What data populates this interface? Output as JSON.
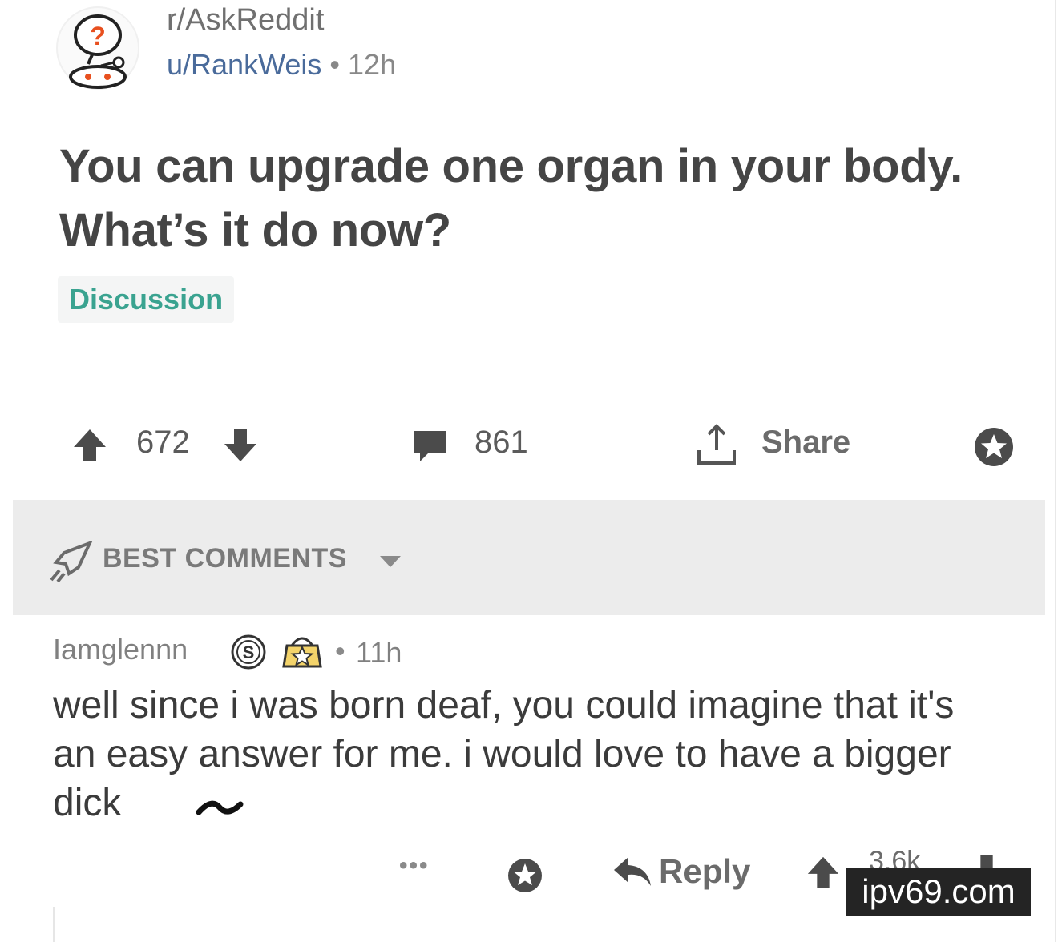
{
  "post": {
    "subreddit": "r/AskReddit",
    "author": "u/RankWeis",
    "separator": "•",
    "age": "12h",
    "title": "You can upgrade one organ in your body. What’s it do now?",
    "flair": "Discussion",
    "score": "672",
    "comments": "861",
    "share_label": "Share"
  },
  "sort": {
    "label": "BEST COMMENTS"
  },
  "comment": {
    "author": "Iamglennn",
    "separator": "•",
    "age": "11h",
    "body": "well since i was born deaf, you could imagine that it's an easy answer for me. i would love to have a bigger dick",
    "more": "•••",
    "reply_label": "Reply",
    "score": "3.6k"
  },
  "watermark": "ipv69.com",
  "icons": {
    "avatar": "askreddit-snoo-icon",
    "upvote": "upvote-arrow-icon",
    "downvote": "downvote-arrow-icon",
    "comments": "comment-bubble-icon",
    "share": "share-icon",
    "save": "star-save-icon",
    "sort": "rocket-icon",
    "reply": "reply-arrow-icon"
  },
  "colors": {
    "flair_text": "#3aa390",
    "username": "#4a6b9b",
    "sort_bar": "#ececec"
  }
}
